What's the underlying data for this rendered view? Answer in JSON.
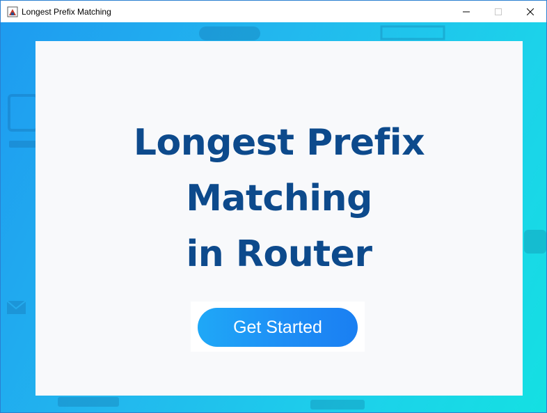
{
  "window": {
    "title": "Longest Prefix Matching",
    "controls": {
      "minimize": "—",
      "maximize": "☐",
      "close": "✕"
    }
  },
  "card": {
    "headline_lines": [
      "Longest Prefix",
      "Matching",
      "in Router"
    ],
    "button_label": "Get Started"
  },
  "colors": {
    "headline": "#0d4a8c",
    "button_start": "#1fa8f7",
    "button_end": "#1a7ff2",
    "background_start": "#1e9bf0",
    "background_end": "#14e0e2",
    "card": "#f8f9fb"
  },
  "icons": {
    "app": "java-app-icon",
    "background": [
      "monitor-icon",
      "envelope-icon",
      "server-icon",
      "router-icon"
    ]
  }
}
